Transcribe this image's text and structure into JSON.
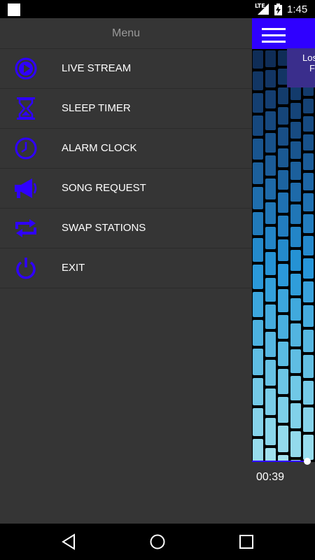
{
  "status_bar": {
    "network": "LTE",
    "time": "1:45"
  },
  "drawer": {
    "title": "Menu",
    "items": [
      {
        "label": "LIVE STREAM",
        "icon": "play-circle-icon"
      },
      {
        "label": "SLEEP TIMER",
        "icon": "hourglass-icon"
      },
      {
        "label": "ALARM CLOCK",
        "icon": "clock-icon"
      },
      {
        "label": "SONG REQUEST",
        "icon": "megaphone-icon"
      },
      {
        "label": "SWAP STATIONS",
        "icon": "swap-icon"
      },
      {
        "label": "EXIT",
        "icon": "power-icon"
      }
    ]
  },
  "player": {
    "banner_text_1": "Los",
    "banner_text_2": "F",
    "elapsed": "00:39",
    "progress": 0.94
  },
  "colors": {
    "accent": "#2f00ff",
    "drawer_bg": "#353535",
    "icon": "#2f00ff",
    "divider": "#2b2b2b"
  },
  "nav_bar": {
    "back": "back-icon",
    "home": "home-icon",
    "recents": "recents-icon"
  }
}
